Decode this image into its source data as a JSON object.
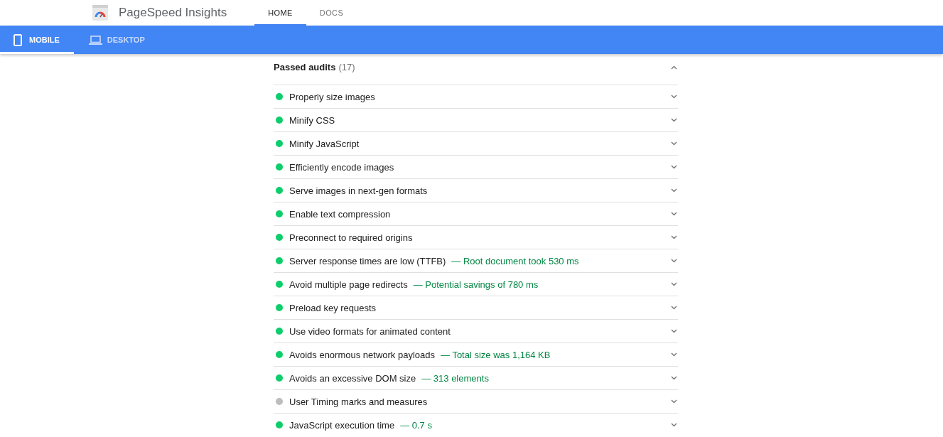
{
  "header": {
    "title": "PageSpeed Insights",
    "tabs": [
      {
        "label": "HOME",
        "selected": true
      },
      {
        "label": "DOCS",
        "selected": false
      }
    ]
  },
  "device_tabs": [
    {
      "label": "MOBILE",
      "kind": "phone",
      "selected": true
    },
    {
      "label": "DESKTOP",
      "kind": "laptop",
      "selected": false
    }
  ],
  "passed_audits": {
    "title": "Passed audits",
    "count": "(17)",
    "expanded": true,
    "audits": [
      {
        "title": "Properly size images",
        "color": "#0cce6b",
        "expanded": false
      },
      {
        "title": "Minify CSS",
        "color": "#0cce6b",
        "expanded": false
      },
      {
        "title": "Minify JavaScript",
        "color": "#0cce6b",
        "expanded": false
      },
      {
        "title": "Efficiently encode images",
        "color": "#0cce6b",
        "expanded": false
      },
      {
        "title": "Serve images in next-gen formats",
        "color": "#0cce6b",
        "expanded": false
      },
      {
        "title": "Enable text compression",
        "color": "#0cce6b",
        "expanded": false
      },
      {
        "title": "Preconnect to required origins",
        "color": "#0cce6b",
        "expanded": false
      },
      {
        "title": "Server response times are low (TTFB)",
        "detail": "— Root document took 530 ms",
        "color": "#0cce6b",
        "expanded": false
      },
      {
        "title": "Avoid multiple page redirects",
        "detail": "— Potential savings of 780 ms",
        "color": "#0cce6b",
        "expanded": false
      },
      {
        "title": "Preload key requests",
        "color": "#0cce6b",
        "expanded": false
      },
      {
        "title": "Use video formats for animated content",
        "color": "#0cce6b",
        "expanded": false
      },
      {
        "title": "Avoids enormous network payloads",
        "detail": "— Total size was 1,164 KB",
        "color": "#0cce6b",
        "expanded": false
      },
      {
        "title": "Avoids an excessive DOM size",
        "detail": "— 313 elements",
        "color": "#0cce6b",
        "expanded": false
      },
      {
        "title": "User Timing marks and measures",
        "color": "#bdbdbd",
        "expanded": false
      },
      {
        "title": "JavaScript execution time",
        "detail": "— 0.7 s",
        "color": "#0cce6b",
        "expanded": false
      }
    ]
  }
}
